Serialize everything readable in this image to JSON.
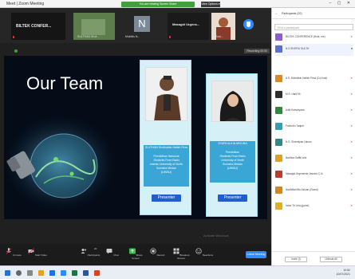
{
  "window": {
    "app_title": "Meet | Zoom Meeting",
    "notice": "You are viewing Screen Share",
    "view_options": "View Options ▾",
    "controls": "– ▢ ✕"
  },
  "gallery": {
    "tiles": [
      {
        "name": "BILTEK CONFER..."
      },
      {
        "name": "SULTHAN Shof..."
      },
      {
        "name": "N",
        "caption": "Mukhlis N..."
      },
      {
        "name": "Masagid Urgens..."
      },
      {
        "name": "Rasi..."
      }
    ],
    "recording_label": "Recording 00:00"
  },
  "slide": {
    "title": "Our Team",
    "members": [
      {
        "name": "SULTHAN Shofiuddin Hafizh Firza",
        "desc": [
          "Pendidikan Nasional",
          "Students From Badu",
          "Islamic University of North",
          "Sumatra Medan",
          "(UINSU)"
        ],
        "button": "Presenter"
      },
      {
        "name": "SYAFA AULIA ARJUNA",
        "desc": [
          "Pendidikan",
          "Students From Badu",
          "University of North",
          "Sumatra Medan",
          "(UINSU)"
        ],
        "button": "Presenter"
      }
    ]
  },
  "toolbar": {
    "items": [
      {
        "label": "Unmute",
        "icon": "microphone-icon"
      },
      {
        "label": "Start Video",
        "icon": "video-camera-icon"
      },
      {
        "label": "Participants",
        "icon": "participants-icon",
        "count": "20"
      },
      {
        "label": "Chat",
        "icon": "chat-icon"
      },
      {
        "label": "Share Screen",
        "icon": "share-screen-icon"
      },
      {
        "label": "Record",
        "icon": "record-icon"
      },
      {
        "label": "Breakout Rooms",
        "icon": "breakout-rooms-icon"
      },
      {
        "label": "Reactions",
        "icon": "reactions-icon"
      }
    ],
    "end_label": "Leave Meeting",
    "watermark": "Activate Windows"
  },
  "participants": {
    "header": "Participants (20)",
    "search_placeholder": "Find a participant",
    "people": [
      {
        "name": "BILTEK CONFERENCE (Host, me)",
        "color": "#8e5bd6",
        "status": "✕"
      },
      {
        "name": "N.S SHOFIU SULTH",
        "color": "#5b6dd6",
        "status": "■"
      },
      {
        "name": "A.S. Mukhlisin Hafizh Firza (Co-host)",
        "color": "#e08a1a",
        "status": "✕"
      },
      {
        "name": "M.S. Hanif M.",
        "color": "#2f2f2f",
        "status": "✕"
      },
      {
        "name": "Aditi Kuswiryana",
        "color": "#2f8a3a",
        "status": "✕"
      },
      {
        "name": "Fahrudin Taqieh",
        "color": "#2fa0b8",
        "status": "✕"
      },
      {
        "name": "N.S. Sharmiyan Hanan",
        "color": "#2f8a8a",
        "status": "✕"
      },
      {
        "name": "Nadhira Safitri Aini",
        "color": "#e0a020",
        "status": "✕"
      },
      {
        "name": "Masagid Urgensinta Jesnimi C.N.",
        "color": "#c0392b",
        "status": "✕"
      },
      {
        "name": "Nadhiifah Bin Azizan (Guest)",
        "color": "#d4881a",
        "status": "✕"
      },
      {
        "name": "Indra Tri Lela (guest)",
        "color": "#e0b020",
        "status": "✕"
      }
    ],
    "footer": {
      "invite": "Invite (I)",
      "unmute_all": "Unmute All"
    }
  },
  "taskbar": {
    "time": "10:52",
    "date": "10/07/2021"
  }
}
